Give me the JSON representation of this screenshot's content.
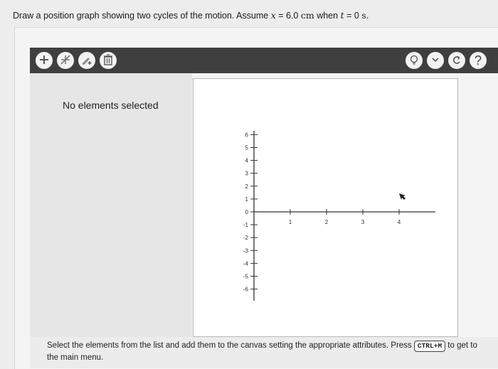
{
  "question": {
    "prefix": "Draw a position graph showing two cycles of the motion. Assume ",
    "var_x": "x",
    "equals1": " = 6.0 ",
    "unit_cm": "cm",
    "when": " when ",
    "var_t": "t",
    "equals2": " = 0 ",
    "unit_s": "s."
  },
  "toolbar": {
    "left_icons": [
      "plus-icon",
      "slash-star-icon",
      "pencil-plus-icon",
      "trash-icon"
    ],
    "right_icons": [
      "bulb-icon",
      "chevron-down-icon",
      "undo-icon",
      "help-icon"
    ],
    "help_label": "?"
  },
  "panel": {
    "status": "No elements selected"
  },
  "graph": {
    "y_ticks": [
      "6",
      "5",
      "4",
      "3",
      "2",
      "1",
      "0",
      "-1",
      "-2",
      "-3",
      "-4",
      "-5",
      "-6"
    ],
    "x_ticks": [
      "1",
      "2",
      "3",
      "4"
    ]
  },
  "footer": {
    "text_before": "Select the elements from the list and add them to the canvas setting the appropriate attributes. Press ",
    "shortcut": "CTRL+M",
    "text_after": " to get to the main menu."
  },
  "colors": {
    "toolbar": "#3f3f3f",
    "canvas": "#ffffff",
    "panel": "#e6e6e6"
  }
}
